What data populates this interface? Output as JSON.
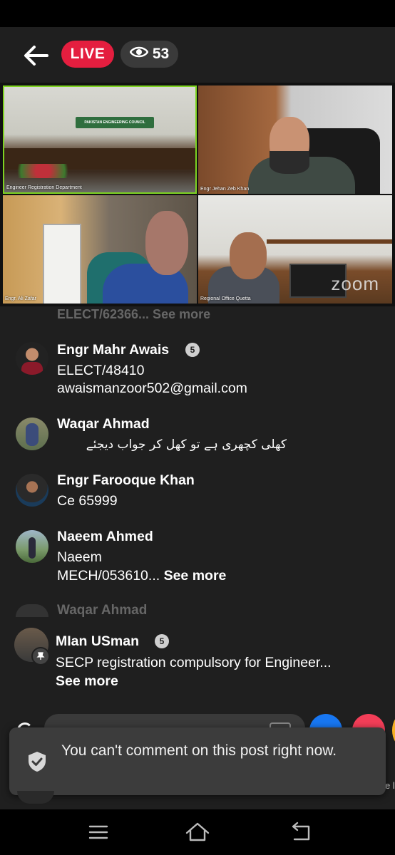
{
  "header": {
    "live_label": "LIVE",
    "viewer_count": "53"
  },
  "video": {
    "tiles": [
      {
        "name": "Engineer Registration Department"
      },
      {
        "name": "Engr Jehan Zeb Khan"
      },
      {
        "name": "Engr. Ali Zafar"
      },
      {
        "name": "Regional Office Quetta"
      }
    ],
    "banner_text": "PAKISTAN ENGINEERING COUNCIL",
    "zoom_watermark": "zoom"
  },
  "comments": {
    "faded_top": "ELECT/62366... See more",
    "items": [
      {
        "name": "Engr Mahr Awais",
        "badge": "5",
        "lines": [
          "ELECT/48410",
          "awaismanzoor502@gmail.com"
        ]
      },
      {
        "name": "Waqar Ahmad",
        "lines": [
          "کھلی کچھری ہے تو کھل کر جواب دیجئے"
        ]
      },
      {
        "name": "Engr Farooque Khan",
        "lines": [
          "Ce 65999"
        ]
      },
      {
        "name": "Naeem Ahmed",
        "lines": [
          "Naeem",
          "MECH/053610..."
        ],
        "see_more": "See more"
      }
    ],
    "faded_bottom": "Waqar Ahmad",
    "pinned": {
      "name": "MIan USman",
      "badge": "5",
      "text": "SECP registration compulsory for Engineer...",
      "see_more": "See more"
    }
  },
  "toast": {
    "message": "You can't comment on this post right now."
  },
  "partial_edge_text": "e l",
  "colors": {
    "live_red": "#e41e3f",
    "speaker_green": "#7ed321",
    "like_blue": "#1877f2",
    "love_red": "#f33e58"
  }
}
